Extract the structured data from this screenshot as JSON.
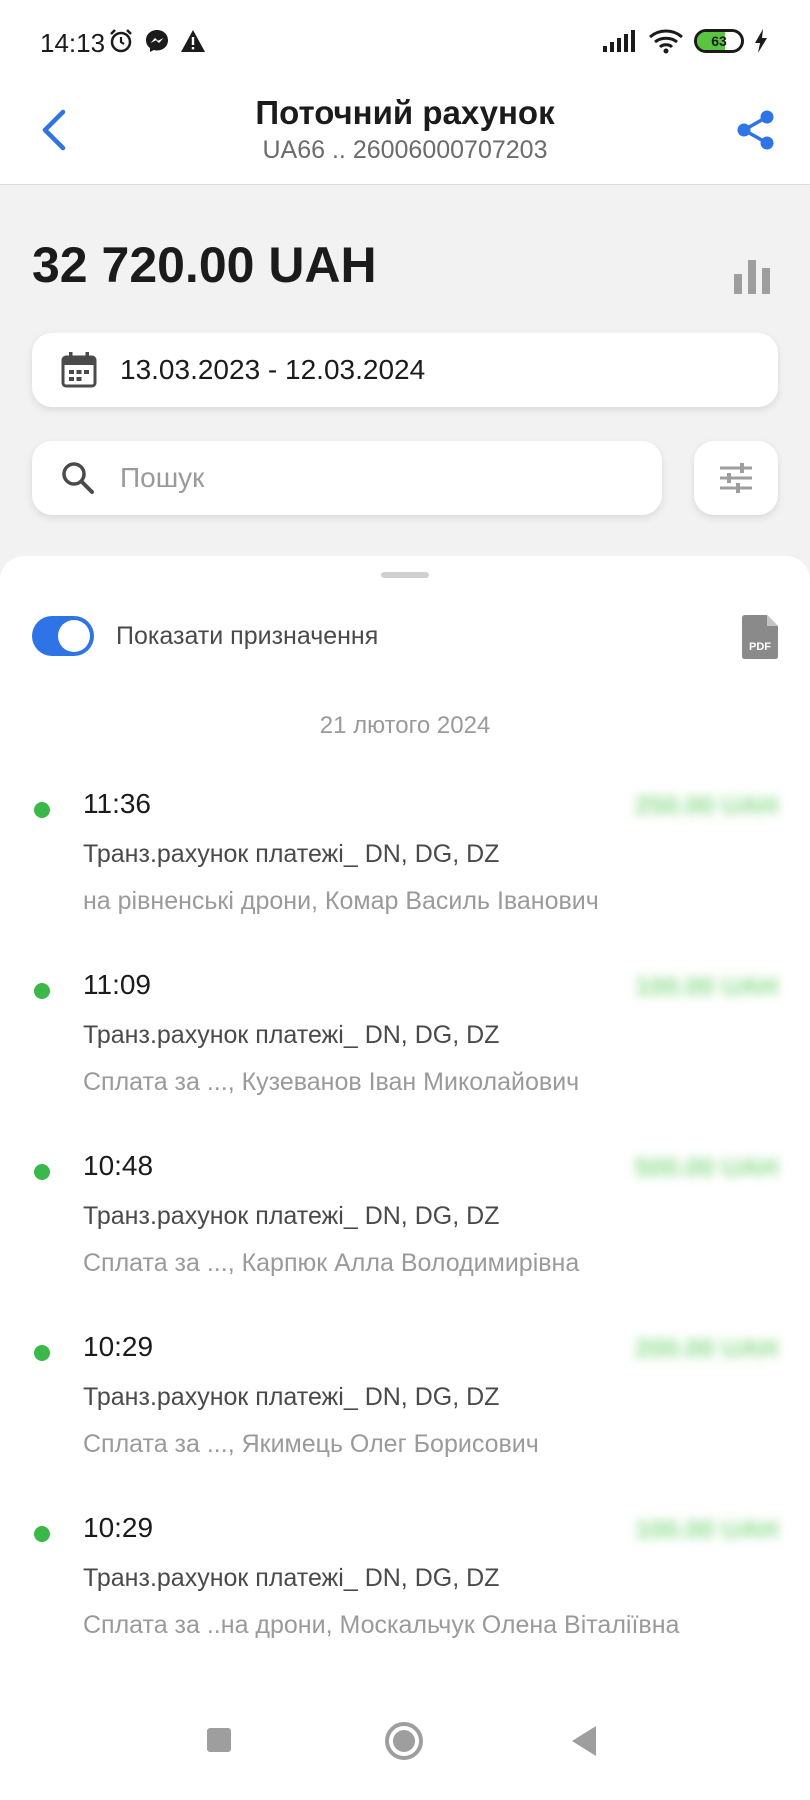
{
  "status_bar": {
    "time": "14:13",
    "battery_label": "63",
    "battery_level_percent": 63,
    "left_icons": [
      "alarm-icon",
      "messenger-icon",
      "warning-icon"
    ],
    "right_icons": [
      "signal-icon",
      "wifi-icon",
      "battery-icon",
      "charging-icon"
    ]
  },
  "header": {
    "title": "Поточний рахунок",
    "subtitle": "UA66 .. 26006000707203",
    "back_icon": "chevron-left-icon",
    "share_icon": "share-icon"
  },
  "balance": "32 720.00 UAH",
  "date_range": "13.03.2023 - 12.03.2024",
  "search": {
    "placeholder": "Пошук",
    "value": ""
  },
  "toggle": {
    "label": "Показати призначення",
    "on": true
  },
  "group_date": "21 лютого 2024",
  "transactions": [
    {
      "time": "11:36",
      "amount": "250.00 UAH",
      "account": "Транз.рахунок платежі_ DN, DG, DZ",
      "purpose": "на рівненські дрони, Комар Василь Іванович"
    },
    {
      "time": "11:09",
      "amount": "100.00 UAH",
      "account": "Транз.рахунок платежі_ DN, DG, DZ",
      "purpose": "Сплата за ..., Кузеванов Іван Миколайович"
    },
    {
      "time": "10:48",
      "amount": "500.00 UAH",
      "account": "Транз.рахунок платежі_ DN, DG, DZ",
      "purpose": "Сплата за ..., Карпюк Алла Володимирівна"
    },
    {
      "time": "10:29",
      "amount": "200.00 UAH",
      "account": "Транз.рахунок платежі_ DN, DG, DZ",
      "purpose": "Сплата за ..., Якимець Олег Борисович"
    },
    {
      "time": "10:29",
      "amount": "100.00 UAH",
      "account": "Транз.рахунок платежі_ DN, DG, DZ",
      "purpose": "Сплата за ..на дрони, Москальчук Олена Віталіївна"
    }
  ],
  "colors": {
    "accent": "#2f74e6",
    "positive_dot": "#3bb84a",
    "amount_green": "#6fd36f",
    "battery_green": "#5ac33f"
  }
}
